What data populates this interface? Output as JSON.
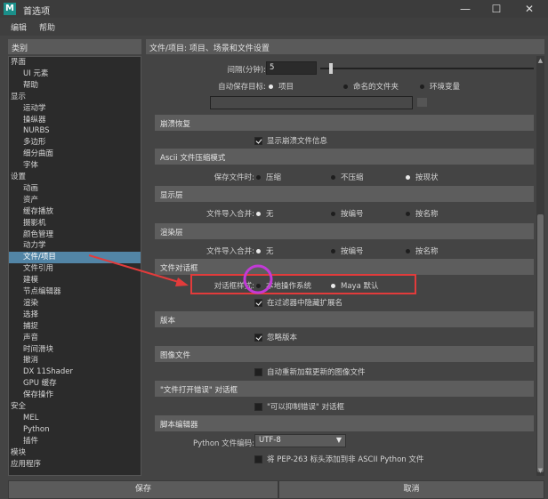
{
  "window": {
    "title": "首选项",
    "app_icon": "M"
  },
  "menu": [
    "编辑",
    "帮助"
  ],
  "categories": {
    "header": "类别",
    "items": [
      {
        "label": "界面",
        "level": 0,
        "selected": false
      },
      {
        "label": "UI 元素",
        "level": 1,
        "selected": false
      },
      {
        "label": "帮助",
        "level": 1,
        "selected": false
      },
      {
        "label": "显示",
        "level": 0,
        "selected": false
      },
      {
        "label": "运动学",
        "level": 1,
        "selected": false
      },
      {
        "label": "操纵器",
        "level": 1,
        "selected": false
      },
      {
        "label": "NURBS",
        "level": 1,
        "selected": false
      },
      {
        "label": "多边形",
        "level": 1,
        "selected": false
      },
      {
        "label": "细分曲面",
        "level": 1,
        "selected": false
      },
      {
        "label": "字体",
        "level": 1,
        "selected": false
      },
      {
        "label": "设置",
        "level": 0,
        "selected": false
      },
      {
        "label": "动画",
        "level": 1,
        "selected": false
      },
      {
        "label": "资产",
        "level": 1,
        "selected": false
      },
      {
        "label": "缓存播放",
        "level": 1,
        "selected": false
      },
      {
        "label": "摄影机",
        "level": 1,
        "selected": false
      },
      {
        "label": "颜色管理",
        "level": 1,
        "selected": false
      },
      {
        "label": "动力学",
        "level": 1,
        "selected": false
      },
      {
        "label": "文件/项目",
        "level": 1,
        "selected": true
      },
      {
        "label": "文件引用",
        "level": 1,
        "selected": false
      },
      {
        "label": "建模",
        "level": 1,
        "selected": false
      },
      {
        "label": "节点编辑器",
        "level": 1,
        "selected": false
      },
      {
        "label": "渲染",
        "level": 1,
        "selected": false
      },
      {
        "label": "选择",
        "level": 1,
        "selected": false
      },
      {
        "label": "捕捉",
        "level": 1,
        "selected": false
      },
      {
        "label": "声音",
        "level": 1,
        "selected": false
      },
      {
        "label": "时间滑块",
        "level": 1,
        "selected": false
      },
      {
        "label": "撤消",
        "level": 1,
        "selected": false
      },
      {
        "label": "DX 11Shader",
        "level": 1,
        "selected": false
      },
      {
        "label": "GPU 缓存",
        "level": 1,
        "selected": false
      },
      {
        "label": "保存操作",
        "level": 1,
        "selected": false
      },
      {
        "label": "安全",
        "level": 0,
        "selected": false
      },
      {
        "label": "MEL",
        "level": 1,
        "selected": false
      },
      {
        "label": "Python",
        "level": 1,
        "selected": false
      },
      {
        "label": "插件",
        "level": 1,
        "selected": false
      },
      {
        "label": "模块",
        "level": 0,
        "selected": false
      },
      {
        "label": "应用程序",
        "level": 0,
        "selected": false
      }
    ]
  },
  "main": {
    "header": "文件/项目: 项目、场景和文件设置",
    "interval_label": "间隔(分钟):",
    "interval_value": "5",
    "autosave_label": "自动保存目标:",
    "autosave_opts": [
      "项目",
      "命名的文件夹",
      "环境变量"
    ],
    "crash": {
      "title": "崩溃恢复",
      "check": "显示崩溃文件信息"
    },
    "ascii": {
      "title": "Ascii 文件压缩模式",
      "label": "保存文件时:",
      "opts": [
        "压缩",
        "不压缩",
        "按现状"
      ]
    },
    "display_layers": {
      "title": "显示层",
      "label": "文件导入合并:",
      "opts": [
        "无",
        "按编号",
        "按名称"
      ]
    },
    "render_layers": {
      "title": "渲染层",
      "label": "文件导入合并:",
      "opts": [
        "无",
        "按编号",
        "按名称"
      ]
    },
    "file_dialog": {
      "title": "文件对话框",
      "label": "对话框样式:",
      "opts": [
        "本地操作系统",
        "Maya 默认"
      ],
      "check": "在过滤器中隐藏扩展名"
    },
    "version": {
      "title": "版本",
      "check": "忽略版本"
    },
    "image_files": {
      "title": "图像文件",
      "check": "自动重新加载更新的图像文件"
    },
    "file_open_error": {
      "title": "\"文件打开错误\" 对话框",
      "check": "\"可以抑制错误\" 对话框"
    },
    "script_editor": {
      "title": "脚本编辑器",
      "encoding_label": "Python 文件编码:",
      "encoding_value": "UTF-8",
      "check": "将 PEP-263 标头添加到非 ASCII Python 文件"
    }
  },
  "buttons": {
    "save": "保存",
    "cancel": "取消"
  },
  "colors": {
    "selection": "#5285a6",
    "annotation_red": "#e23b3b",
    "annotation_circle": "#c23ad6"
  }
}
